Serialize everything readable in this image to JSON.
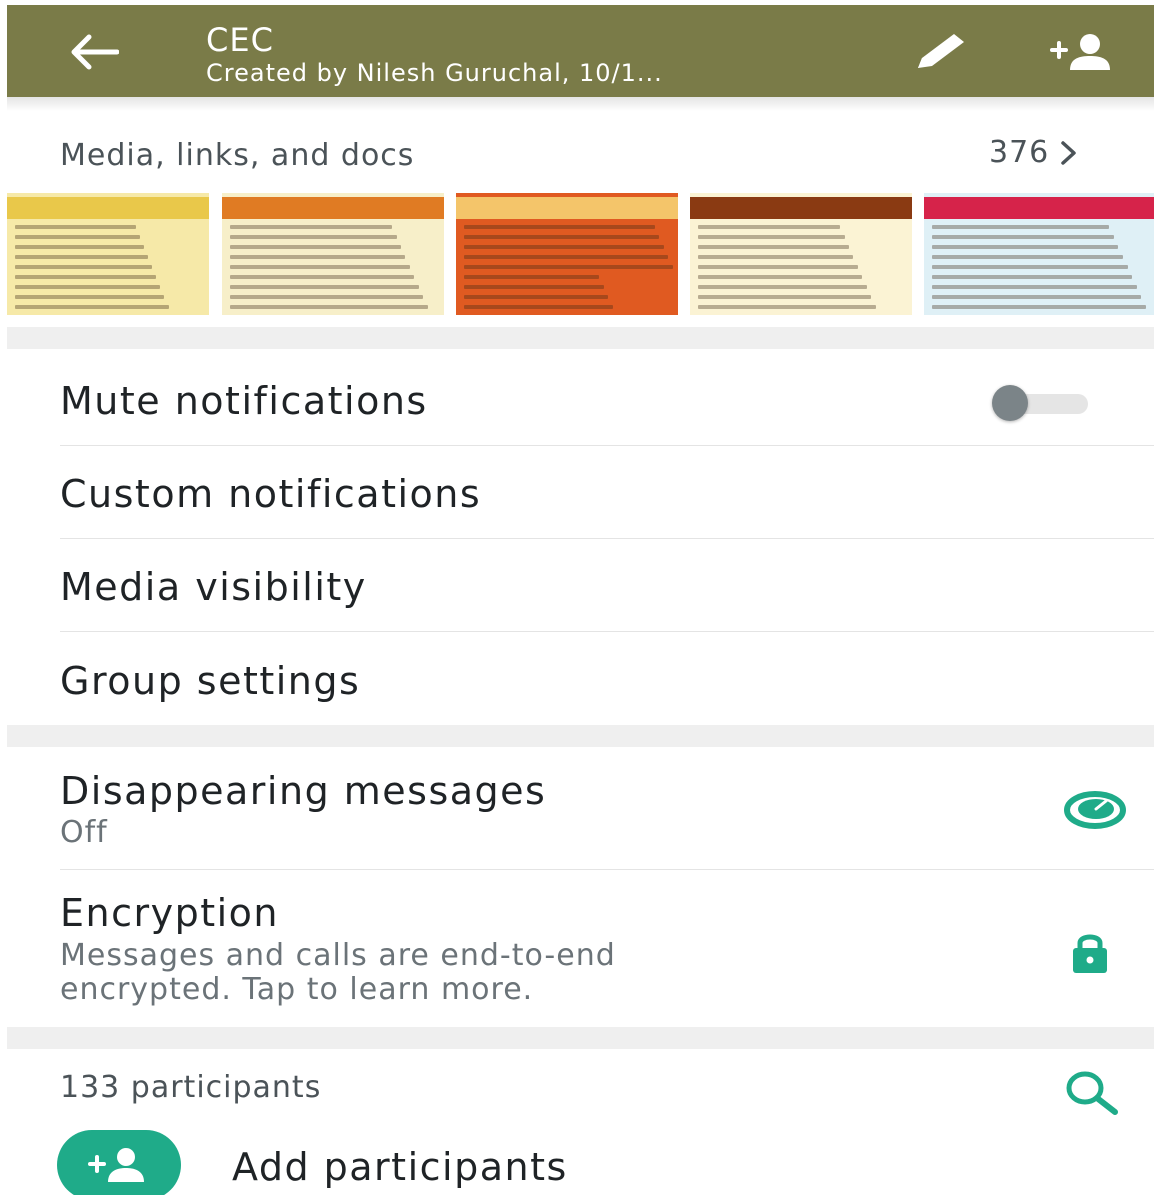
{
  "header": {
    "title": "CEC",
    "subtitle": "Created by Nilesh Guruchal, 10/1..."
  },
  "media": {
    "label": "Media, links, and docs",
    "count": "376",
    "thumbnails": [
      {
        "name": "poster-1",
        "bg": "#f6e9a8",
        "accent": "#e9c84a"
      },
      {
        "name": "poster-2",
        "bg": "#f7efc9",
        "accent": "#e07b23"
      },
      {
        "name": "poster-3",
        "bg": "#e05a21",
        "accent": "#f4c56a"
      },
      {
        "name": "poster-4",
        "bg": "#fbf3d4",
        "accent": "#8a3a12"
      },
      {
        "name": "poster-5",
        "bg": "#dff0f6",
        "accent": "#d6234a"
      }
    ]
  },
  "settings": {
    "mute": {
      "label": "Mute notifications",
      "enabled": false
    },
    "custom": {
      "label": "Custom notifications"
    },
    "visibility": {
      "label": "Media visibility"
    },
    "group": {
      "label": "Group settings"
    },
    "disappearing": {
      "label": "Disappearing messages",
      "value": "Off"
    },
    "encryption": {
      "label": "Encryption",
      "line1": "Messages and calls are end-to-end",
      "line2": "encrypted. Tap to learn more."
    }
  },
  "participants": {
    "count_label": "133 participants",
    "add_label": "Add participants"
  },
  "colors": {
    "header": "#7a7b48",
    "accent": "#1fab89"
  },
  "icons": {
    "back": "back-arrow-icon",
    "edit": "pencil-icon",
    "add_person": "add-person-icon",
    "chevron": "chevron-right-icon",
    "timer": "timer-icon",
    "lock": "lock-icon",
    "search": "search-icon"
  }
}
